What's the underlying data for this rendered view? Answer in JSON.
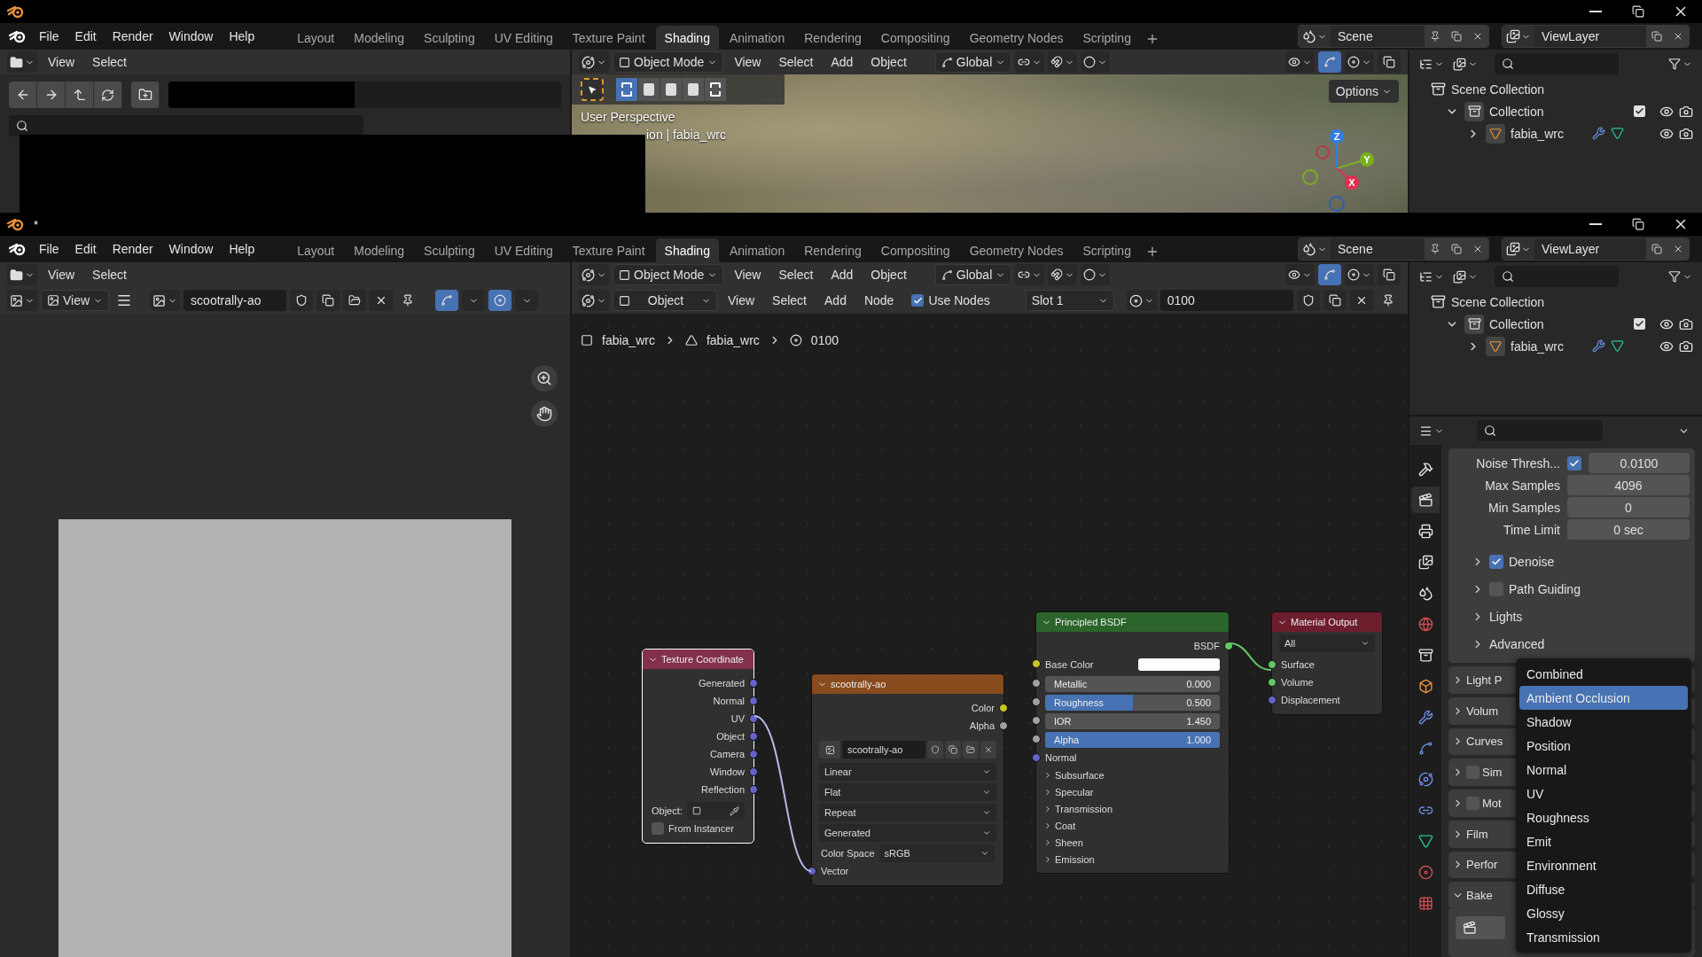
{
  "windows": [
    {
      "menus": [
        "File",
        "Edit",
        "Render",
        "Window",
        "Help"
      ],
      "workspaces": [
        {
          "label": "Layout",
          "selected": false
        },
        {
          "label": "Modeling",
          "selected": false
        },
        {
          "label": "Sculpting",
          "selected": false
        },
        {
          "label": "UV Editing",
          "selected": false
        },
        {
          "label": "Texture Paint",
          "selected": false
        },
        {
          "label": "Shading",
          "selected": true
        },
        {
          "label": "Animation",
          "selected": false
        },
        {
          "label": "Rendering",
          "selected": false
        },
        {
          "label": "Compositing",
          "selected": false
        },
        {
          "label": "Geometry Nodes",
          "selected": false
        },
        {
          "label": "Scripting",
          "selected": false
        }
      ],
      "scene": "Scene",
      "view_layer": "ViewLayer",
      "left_editor": {
        "kind": "file_browser",
        "menus": [
          "View",
          "Select"
        ]
      },
      "main_editor": {
        "kind": "viewport",
        "mode": "Object Mode",
        "menus": [
          "View",
          "Select",
          "Add",
          "Object"
        ],
        "orientation": "Global",
        "options": "Options",
        "overlay_lines": [
          "User Perspective",
          "ion | fabia_wrc"
        ],
        "axes": [
          "Z",
          "Y",
          "X"
        ]
      },
      "outliner": {
        "root": "Scene Collection",
        "items": [
          {
            "label": "Collection",
            "kind": "collection",
            "expanded": true,
            "checked": true,
            "children": [
              {
                "label": "fabia_wrc",
                "kind": "object",
                "expanded": false
              }
            ]
          }
        ]
      }
    },
    {
      "title": "*",
      "menus": [
        "File",
        "Edit",
        "Render",
        "Window",
        "Help"
      ],
      "workspaces": [
        {
          "label": "Layout",
          "selected": false
        },
        {
          "label": "Modeling",
          "selected": false
        },
        {
          "label": "Sculpting",
          "selected": false
        },
        {
          "label": "UV Editing",
          "selected": false
        },
        {
          "label": "Texture Paint",
          "selected": false
        },
        {
          "label": "Shading",
          "selected": true
        },
        {
          "label": "Animation",
          "selected": false
        },
        {
          "label": "Rendering",
          "selected": false
        },
        {
          "label": "Compositing",
          "selected": false
        },
        {
          "label": "Geometry Nodes",
          "selected": false
        },
        {
          "label": "Scripting",
          "selected": false
        }
      ],
      "scene": "Scene",
      "view_layer": "ViewLayer",
      "left_editor": {
        "kind": "image_editor",
        "menus": [
          "View",
          "Select"
        ],
        "view_menu": "View",
        "image": "scootrally-ao"
      },
      "main_editor": {
        "kind": "node_editor",
        "mode": "Object Mode",
        "menus": [
          "View",
          "Select",
          "Add",
          "Object"
        ],
        "orientation": "Global",
        "shader_type": "Object",
        "node_menus": [
          "View",
          "Select",
          "Add",
          "Node"
        ],
        "use_nodes": {
          "label": "Use Nodes",
          "checked": true
        },
        "slot": "Slot 1",
        "material": "0100",
        "breadcrumbs": [
          "fabia_wrc",
          "fabia_wrc",
          "0100"
        ],
        "nodes": [
          {
            "kind": "texture_coordinate",
            "title": "Texture Coordinate",
            "outputs": [
              {
                "label": "Generated",
                "color": "#6363c7"
              },
              {
                "label": "Normal",
                "color": "#6363c7"
              },
              {
                "label": "UV",
                "color": "#6363c7"
              },
              {
                "label": "Object",
                "color": "#6363c7"
              },
              {
                "label": "Camera",
                "color": "#6363c7"
              },
              {
                "label": "Window",
                "color": "#6363c7"
              },
              {
                "label": "Reflection",
                "color": "#6363c7"
              }
            ],
            "object_label": "Object:",
            "from_instancer": {
              "label": "From Instancer",
              "checked": false
            }
          },
          {
            "kind": "image_texture",
            "title": "scootrally-ao",
            "outputs": [
              {
                "label": "Color",
                "color": "#c7c729"
              },
              {
                "label": "Alpha",
                "color": "#a1a1a1"
              }
            ],
            "image": "scootrally-ao",
            "dropdowns": [
              "Linear",
              "Flat",
              "Repeat",
              "Generated"
            ],
            "color_space_label": "Color Space",
            "color_space": "sRGB",
            "inputs": [
              {
                "label": "Vector",
                "color": "#6363c7"
              }
            ]
          },
          {
            "kind": "principled_bsdf",
            "title": "Principled BSDF",
            "outputs": [
              {
                "label": "BSDF",
                "color": "#63c763"
              }
            ],
            "inputs": [
              {
                "kind": "color",
                "label": "Base Color",
                "color": "#c7c729"
              },
              {
                "kind": "slider",
                "label": "Metallic",
                "value": "0.000",
                "level": 0,
                "color": "#a1a1a1"
              },
              {
                "kind": "slider",
                "label": "Roughness",
                "value": "0.500",
                "level": 0.5,
                "color": "#a1a1a1"
              },
              {
                "kind": "number",
                "label": "IOR",
                "value": "1.450",
                "color": "#a1a1a1"
              },
              {
                "kind": "slider",
                "label": "Alpha",
                "value": "1.000",
                "level": 1,
                "color": "#a1a1a1"
              },
              {
                "kind": "socket",
                "label": "Normal",
                "color": "#6363c7"
              }
            ],
            "sections": [
              "Subsurface",
              "Specular",
              "Transmission",
              "Coat",
              "Sheen",
              "Emission"
            ]
          },
          {
            "kind": "material_output",
            "title": "Material Output",
            "target": "All",
            "inputs": [
              {
                "label": "Surface",
                "color": "#63c763"
              },
              {
                "label": "Volume",
                "color": "#63c763"
              },
              {
                "label": "Displacement",
                "color": "#6363c7"
              }
            ]
          }
        ]
      },
      "outliner": {
        "root": "Scene Collection",
        "items": [
          {
            "label": "Collection",
            "kind": "collection",
            "expanded": true,
            "checked": true,
            "children": [
              {
                "label": "fabia_wrc",
                "kind": "object",
                "expanded": false
              }
            ]
          }
        ]
      },
      "properties": {
        "tabs": [
          {
            "kind": "tool",
            "selected": false
          },
          {
            "kind": "render",
            "selected": true
          },
          {
            "kind": "output",
            "selected": false
          },
          {
            "kind": "view_layer",
            "selected": false
          },
          {
            "kind": "scene",
            "selected": false
          },
          {
            "kind": "world",
            "selected": false
          },
          {
            "kind": "collection",
            "selected": false
          },
          {
            "kind": "object",
            "selected": false
          },
          {
            "kind": "modifiers",
            "selected": false
          },
          {
            "kind": "particles",
            "selected": false
          },
          {
            "kind": "physics",
            "selected": false
          },
          {
            "kind": "constraints",
            "selected": false
          },
          {
            "kind": "data",
            "selected": false
          },
          {
            "kind": "material",
            "selected": false
          },
          {
            "kind": "texture",
            "selected": false
          }
        ],
        "fields": [
          {
            "kind": "toggle",
            "label": "Noise Thresh...",
            "checked": true,
            "value": "0.0100"
          },
          {
            "kind": "plain",
            "label": "Max Samples",
            "value": "4096"
          },
          {
            "kind": "plain",
            "label": "Min Samples",
            "value": "0"
          },
          {
            "kind": "plain",
            "label": "Time Limit",
            "value": "0 sec"
          }
        ],
        "subpanels": [
          {
            "kind": "checkbox",
            "label": "Denoise",
            "checked": true
          },
          {
            "kind": "checkbox",
            "label": "Path Guiding",
            "checked": false
          },
          {
            "kind": "plain",
            "label": "Lights"
          },
          {
            "kind": "plain",
            "label": "Advanced"
          }
        ],
        "panels": [
          {
            "kind": "plain",
            "label": "Light P",
            "expanded": false
          },
          {
            "kind": "plain",
            "label": "Volum",
            "expanded": false
          },
          {
            "kind": "plain",
            "label": "Curves",
            "expanded": false
          },
          {
            "kind": "checkbox",
            "label": "Sim",
            "checked": false,
            "expanded": false
          },
          {
            "kind": "checkbox",
            "label": "Mot",
            "checked": false,
            "expanded": false
          },
          {
            "kind": "plain",
            "label": "Film",
            "expanded": false
          },
          {
            "kind": "plain",
            "label": "Perfor",
            "expanded": false
          },
          {
            "kind": "plain",
            "label": "Bake",
            "expanded": true
          }
        ],
        "bake_menu": [
          {
            "label": "Combined",
            "selected": false
          },
          {
            "label": "Ambient Occlusion",
            "selected": true
          },
          {
            "label": "Shadow",
            "selected": false
          },
          {
            "label": "Position",
            "selected": false
          },
          {
            "label": "Normal",
            "selected": false
          },
          {
            "label": "UV",
            "selected": false
          },
          {
            "label": "Roughness",
            "selected": false
          },
          {
            "label": "Emit",
            "selected": false
          },
          {
            "label": "Environment",
            "selected": false
          },
          {
            "label": "Diffuse",
            "selected": false
          },
          {
            "label": "Glossy",
            "selected": false
          },
          {
            "label": "Transmission",
            "selected": false
          }
        ]
      }
    }
  ]
}
